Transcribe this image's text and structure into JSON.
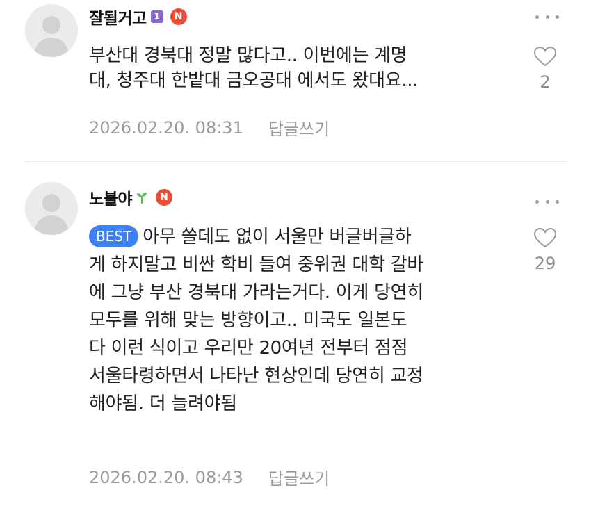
{
  "comments": [
    {
      "nickname": "잘될거고",
      "level_badge": "1",
      "naver_badge": "N",
      "best_label": "",
      "text": "부산대 경북대 정말 많다고.. 이번에는 계명\n대, 청주대 한밭대 금오공대 에서도 왔대요...",
      "likes": "2",
      "timestamp": "2026.02.20. 08:31",
      "reply_label": "답글쓰기"
    },
    {
      "nickname": "노불야",
      "level_badge": "",
      "naver_badge": "N",
      "best_label": "BEST",
      "text": "아무 쓸데도 없이 서울만 버글버글하\n게 하지말고 비싼 학비 들여 중위권 대학 갈바\n에 그냥 부산 경북대 가라는거다. 이게 당연히\n모두를 위해 맞는 방향이고.. 미국도 일본도\n다 이런 식이고 우리만 20여년 전부터 점점\n서울타령하면서 나타난 현상인데 당연히 교정\n해야됨. 더 늘려야됨",
      "likes": "29",
      "timestamp": "2026.02.20. 08:43",
      "reply_label": "답글쓰기"
    }
  ],
  "colors": {
    "best_badge": "#3b82f6",
    "naver_badge": "#f04b37",
    "level_badge": "#8a63d2",
    "meta_text": "#9a9a9a"
  },
  "icons": [
    "avatar-placeholder",
    "level-badge",
    "sprout-icon",
    "naver-badge",
    "more-icon",
    "heart-icon"
  ]
}
